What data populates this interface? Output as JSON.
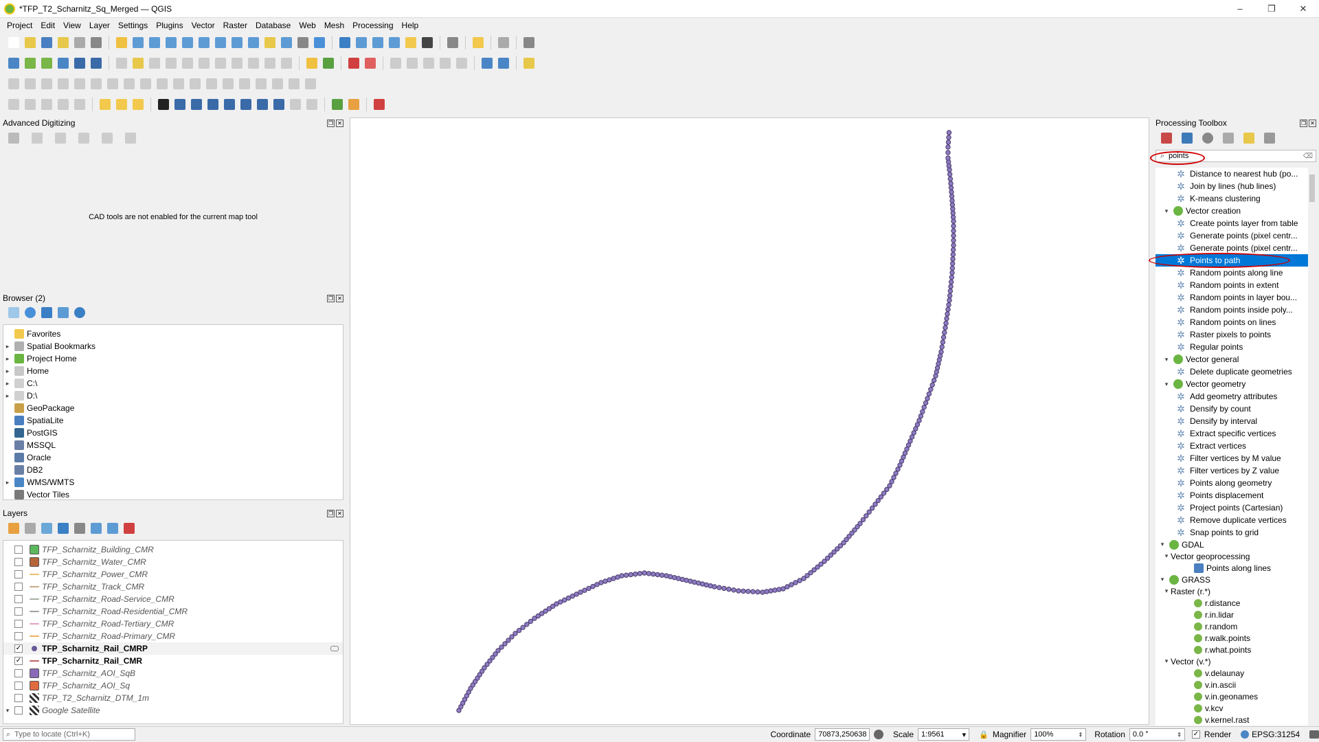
{
  "window": {
    "title": "*TFP_T2_Scharnitz_Sq_Merged — QGIS",
    "minimize": "–",
    "maximize": "❐",
    "close": "✕"
  },
  "menu": [
    "Project",
    "Edit",
    "View",
    "Layer",
    "Settings",
    "Plugins",
    "Vector",
    "Raster",
    "Database",
    "Web",
    "Mesh",
    "Processing",
    "Help"
  ],
  "advanced_digitizing": {
    "title": "Advanced Digitizing",
    "message": "CAD tools are not enabled for the current map tool"
  },
  "browser": {
    "title": "Browser (2)",
    "items": [
      {
        "label": "Favorites",
        "expand": "",
        "icon": "#f2c94c"
      },
      {
        "label": "Spatial Bookmarks",
        "expand": "▸",
        "icon": "#b0b0b0"
      },
      {
        "label": "Project Home",
        "expand": "▸",
        "icon": "#6bb542"
      },
      {
        "label": "Home",
        "expand": "▸",
        "icon": "#c8c8c8"
      },
      {
        "label": "C:\\",
        "expand": "▸",
        "icon": "#d0d0d0"
      },
      {
        "label": "D:\\",
        "expand": "▸",
        "icon": "#d0d0d0"
      },
      {
        "label": "GeoPackage",
        "expand": "",
        "icon": "#c9a04a"
      },
      {
        "label": "SpatiaLite",
        "expand": "",
        "icon": "#4a7fc1"
      },
      {
        "label": "PostGIS",
        "expand": "",
        "icon": "#336791"
      },
      {
        "label": "MSSQL",
        "expand": "",
        "icon": "#6a7fa5"
      },
      {
        "label": "Oracle",
        "expand": "",
        "icon": "#5b7ba8"
      },
      {
        "label": "DB2",
        "expand": "",
        "icon": "#6a7fa5"
      },
      {
        "label": "WMS/WMTS",
        "expand": "▸",
        "icon": "#4a86c5"
      },
      {
        "label": "Vector Tiles",
        "expand": "",
        "icon": "#7a7a7a"
      }
    ]
  },
  "layers": {
    "title": "Layers",
    "items": [
      {
        "name": "TFP_Scharnitz_Building_CMR",
        "checked": false,
        "style": "italic",
        "swatch": "#5cb85c",
        "kind": "fill"
      },
      {
        "name": "TFP_Scharnitz_Water_CMR",
        "checked": false,
        "style": "italic",
        "swatch": "#b5653a",
        "kind": "fill"
      },
      {
        "name": "TFP_Scharnitz_Power_CMR",
        "checked": false,
        "style": "italic",
        "swatch": "#e8c26b",
        "kind": "line"
      },
      {
        "name": "TFP_Scharnitz_Track_CMR",
        "checked": false,
        "style": "italic",
        "swatch": "#c9a98a",
        "kind": "line"
      },
      {
        "name": "TFP_Scharnitz_Road-Service_CMR",
        "checked": false,
        "style": "italic",
        "swatch": "#a7b0a0",
        "kind": "line"
      },
      {
        "name": "TFP_Scharnitz_Road-Residential_CMR",
        "checked": false,
        "style": "italic",
        "swatch": "#a0a0a0",
        "kind": "line"
      },
      {
        "name": "TFP_Scharnitz_Road-Tertiary_CMR",
        "checked": false,
        "style": "italic",
        "swatch": "#e0a0c0",
        "kind": "line"
      },
      {
        "name": "TFP_Scharnitz_Road-Primary_CMR",
        "checked": false,
        "style": "italic",
        "swatch": "#f0b060",
        "kind": "line"
      },
      {
        "name": "TFP_Scharnitz_Rail_CMRP",
        "checked": true,
        "style": "bold",
        "swatch": "#6a5a9a",
        "kind": "point"
      },
      {
        "name": "TFP_Scharnitz_Rail_CMR",
        "checked": true,
        "style": "bold",
        "swatch": "#c06060",
        "kind": "line"
      },
      {
        "name": "TFP_Scharnitz_AOI_SqB",
        "checked": false,
        "style": "italic",
        "swatch": "#8a6ab8",
        "kind": "fill"
      },
      {
        "name": "TFP_Scharnitz_AOI_Sq",
        "checked": false,
        "style": "italic",
        "swatch": "#e06a40",
        "kind": "fill"
      },
      {
        "name": "TFP_T2_Scharnitz_DTM_1m",
        "checked": false,
        "style": "italic",
        "swatch": "#333333",
        "kind": "raster"
      },
      {
        "name": "Google Satellite",
        "checked": false,
        "style": "italic",
        "swatch": "#333333",
        "kind": "raster"
      }
    ]
  },
  "toolbox": {
    "title": "Processing Toolbox",
    "search_value": "points",
    "items": [
      {
        "label": "Distance to nearest hub (po...",
        "level": 2,
        "type": "alg"
      },
      {
        "label": "Join by lines (hub lines)",
        "level": 2,
        "type": "alg"
      },
      {
        "label": "K-means clustering",
        "level": 2,
        "type": "alg"
      },
      {
        "label": "Vector creation",
        "level": 1,
        "type": "group"
      },
      {
        "label": "Create points layer from table",
        "level": 2,
        "type": "alg"
      },
      {
        "label": "Generate points (pixel centr...",
        "level": 2,
        "type": "alg"
      },
      {
        "label": "Generate points (pixel centr...",
        "level": 2,
        "type": "alg"
      },
      {
        "label": "Points to path",
        "level": 2,
        "type": "alg",
        "selected": true
      },
      {
        "label": "Random points along line",
        "level": 2,
        "type": "alg"
      },
      {
        "label": "Random points in extent",
        "level": 2,
        "type": "alg"
      },
      {
        "label": "Random points in layer bou...",
        "level": 2,
        "type": "alg"
      },
      {
        "label": "Random points inside poly...",
        "level": 2,
        "type": "alg"
      },
      {
        "label": "Random points on lines",
        "level": 2,
        "type": "alg"
      },
      {
        "label": "Raster pixels to points",
        "level": 2,
        "type": "alg"
      },
      {
        "label": "Regular points",
        "level": 2,
        "type": "alg"
      },
      {
        "label": "Vector general",
        "level": 1,
        "type": "group"
      },
      {
        "label": "Delete duplicate geometries",
        "level": 2,
        "type": "alg"
      },
      {
        "label": "Vector geometry",
        "level": 1,
        "type": "group"
      },
      {
        "label": "Add geometry attributes",
        "level": 2,
        "type": "alg"
      },
      {
        "label": "Densify by count",
        "level": 2,
        "type": "alg"
      },
      {
        "label": "Densify by interval",
        "level": 2,
        "type": "alg"
      },
      {
        "label": "Extract specific vertices",
        "level": 2,
        "type": "alg"
      },
      {
        "label": "Extract vertices",
        "level": 2,
        "type": "alg"
      },
      {
        "label": "Filter vertices by M value",
        "level": 2,
        "type": "alg"
      },
      {
        "label": "Filter vertices by Z value",
        "level": 2,
        "type": "alg"
      },
      {
        "label": "Points along geometry",
        "level": 2,
        "type": "alg"
      },
      {
        "label": "Points displacement",
        "level": 2,
        "type": "alg"
      },
      {
        "label": "Project points (Cartesian)",
        "level": 2,
        "type": "alg"
      },
      {
        "label": "Remove duplicate vertices",
        "level": 2,
        "type": "alg"
      },
      {
        "label": "Snap points to grid",
        "level": 2,
        "type": "alg"
      },
      {
        "label": "GDAL",
        "level": 0,
        "type": "provider"
      },
      {
        "label": "Vector geoprocessing",
        "level": 1,
        "type": "subgroup"
      },
      {
        "label": "Points along lines",
        "level": 3,
        "type": "gdal"
      },
      {
        "label": "GRASS",
        "level": 0,
        "type": "provider"
      },
      {
        "label": "Raster (r.*)",
        "level": 1,
        "type": "subgroup"
      },
      {
        "label": "r.distance",
        "level": 3,
        "type": "grass"
      },
      {
        "label": "r.in.lidar",
        "level": 3,
        "type": "grass"
      },
      {
        "label": "r.random",
        "level": 3,
        "type": "grass"
      },
      {
        "label": "r.walk.points",
        "level": 3,
        "type": "grass"
      },
      {
        "label": "r.what.points",
        "level": 3,
        "type": "grass"
      },
      {
        "label": "Vector (v.*)",
        "level": 1,
        "type": "subgroup"
      },
      {
        "label": "v.delaunay",
        "level": 3,
        "type": "grass"
      },
      {
        "label": "v.in.ascii",
        "level": 3,
        "type": "grass"
      },
      {
        "label": "v.in.geonames",
        "level": 3,
        "type": "grass"
      },
      {
        "label": "v.kcv",
        "level": 3,
        "type": "grass"
      },
      {
        "label": "v.kernel.rast",
        "level": 3,
        "type": "grass"
      }
    ]
  },
  "statusbar": {
    "locator_placeholder": "Type to locate (Ctrl+K)",
    "coordinate_label": "Coordinate",
    "coordinate_value": "70873,250638",
    "scale_label": "Scale",
    "scale_value": "1:9561",
    "magnifier_label": "Magnifier",
    "magnifier_value": "100%",
    "rotation_label": "Rotation",
    "rotation_value": "0.0 °",
    "render_label": "Render",
    "crs": "EPSG:31254"
  },
  "colors": {
    "point_fill": "#8e7cc3",
    "point_stroke": "#4a3a6a",
    "selection": "#0078d7",
    "annotation": "#d00000"
  }
}
